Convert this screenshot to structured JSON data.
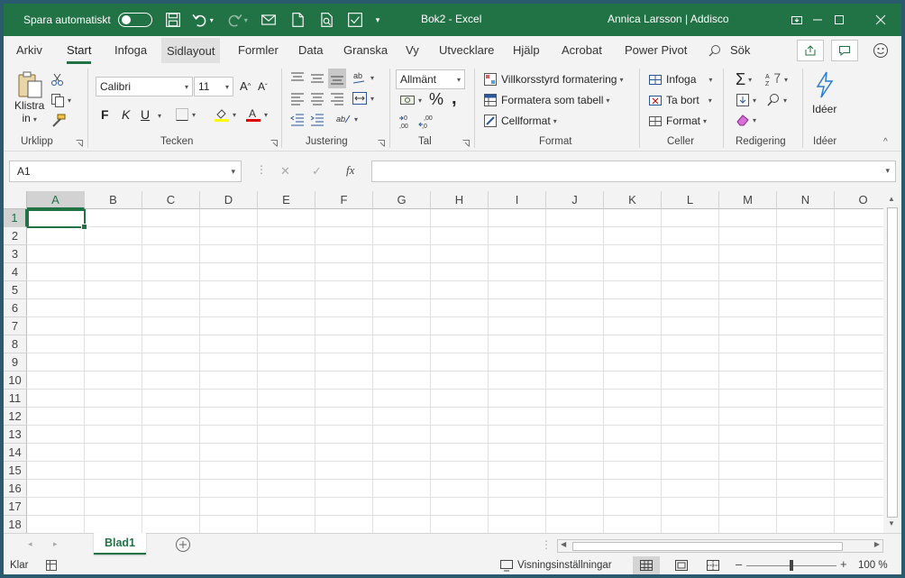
{
  "titlebar": {
    "autosave_label": "Spara automatiskt",
    "doc_title": "Bok2  -  Excel",
    "user": "Annica Larsson | Addisco"
  },
  "tabs": [
    "Arkiv",
    "Start",
    "Infoga",
    "Sidlayout",
    "Formler",
    "Data",
    "Granska",
    "Vy",
    "Utvecklare",
    "Hjälp",
    "Acrobat",
    "Power Pivot"
  ],
  "search_label": "Sök",
  "ribbon": {
    "clipboard": {
      "paste_line1": "Klistra",
      "paste_line2": "in",
      "group": "Urklipp"
    },
    "font": {
      "name": "Calibri",
      "size": "11",
      "bold": "F",
      "italic": "K",
      "underline": "U",
      "group": "Tecken"
    },
    "alignment": {
      "group": "Justering"
    },
    "number": {
      "format": "Allmänt",
      "group": "Tal"
    },
    "styles": {
      "conditional": "Villkorsstyrd formatering",
      "table": "Formatera som tabell",
      "cell": "Cellformat",
      "group": "Format"
    },
    "cells": {
      "insert": "Infoga",
      "delete": "Ta bort",
      "format": "Format",
      "group": "Celler"
    },
    "editing": {
      "group": "Redigering"
    },
    "ideas": {
      "label": "Idéer",
      "group": "Idéer"
    }
  },
  "formula_bar": {
    "namebox": "A1",
    "cancel": "✕",
    "enter": "✓",
    "fx": "fx",
    "value": ""
  },
  "columns": [
    "A",
    "B",
    "C",
    "D",
    "E",
    "F",
    "G",
    "H",
    "I",
    "J",
    "K",
    "L",
    "M",
    "N",
    "O"
  ],
  "rows": [
    "1",
    "2",
    "3",
    "4",
    "5",
    "6",
    "7",
    "8",
    "9",
    "10",
    "11",
    "12",
    "13",
    "14",
    "15",
    "16",
    "17",
    "18"
  ],
  "active_cell": "A1",
  "sheets": [
    "Blad1"
  ],
  "status": {
    "ready": "Klar",
    "display_settings": "Visningsinställningar",
    "zoom": "100 %"
  },
  "colors": {
    "accent": "#217346"
  }
}
